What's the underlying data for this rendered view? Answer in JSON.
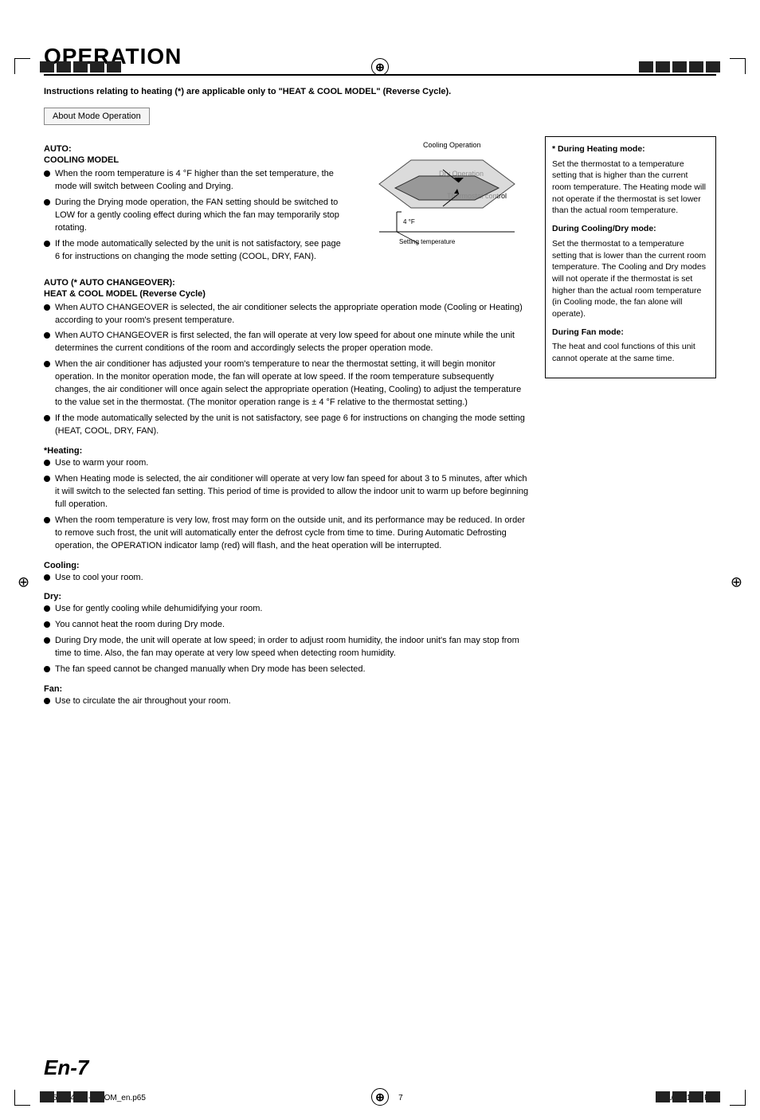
{
  "page": {
    "title": "OPERATION",
    "page_number": "En-7",
    "footer_left": "9359944072-01_OM_en.p65",
    "footer_center": "7",
    "footer_right": "1/21/10, 1:50 PM"
  },
  "instruction_note": "Instructions relating to heating (*) are applicable only to \"HEAT & COOL MODEL\" (Reverse Cycle).",
  "about_mode_label": "About Mode Operation",
  "auto_section": {
    "heading": "AUTO:",
    "subheading": "COOLING MODEL",
    "bullets": [
      "When the room temperature is 4 °F higher than the set temperature, the mode will switch between Cooling and Drying.",
      "During the Drying mode operation, the FAN setting should be switched to LOW for a gently cooling effect during which the fan may temporarily stop rotating.",
      "If the mode automatically selected by the unit is not satisfactory, see page 6 for instructions on changing the mode setting (COOL, DRY, FAN)."
    ]
  },
  "diagram": {
    "label_cooling": "Cooling Operation",
    "label_dry": "Dry Operation",
    "label_thermostat": "Thermostat control",
    "label_4f": "4 °F",
    "label_setting": "Setting temperature"
  },
  "auto_changeover_section": {
    "heading": "AUTO (* AUTO CHANGEOVER):",
    "subheading": "HEAT & COOL MODEL (Reverse Cycle)",
    "bullets": [
      "When AUTO CHANGEOVER is selected, the air conditioner selects the appropriate operation mode (Cooling or Heating) according to your room's present temperature.",
      "When AUTO CHANGEOVER is first selected, the fan will operate at very low speed for about one minute while the unit determines the current conditions of the room and accordingly selects the proper operation mode.",
      "When the air conditioner has adjusted your room's temperature to near the thermostat setting, it will begin monitor operation. In the monitor operation mode, the fan will operate at low speed. If the room temperature subsequently changes, the air conditioner will once again select the appropriate operation (Heating, Cooling) to adjust the temperature to the value set in the thermostat. (The monitor operation range is ± 4 °F relative to the thermostat setting.)",
      "If the mode automatically selected by the unit is not satisfactory, see page 6 for instructions on changing the mode setting (HEAT, COOL, DRY, FAN)."
    ]
  },
  "heating_section": {
    "heading": "*Heating:",
    "bullets": [
      "Use to warm your room.",
      "When Heating mode is selected, the air conditioner will operate at very low fan speed for about 3 to 5 minutes, after which it will switch to the selected fan setting. This period of time is provided to allow the indoor unit to warm up before beginning full operation.",
      "When the room temperature is very low, frost may form on the outside unit, and its performance may be reduced. In order to remove such frost, the unit will automatically enter the defrost cycle from time to time. During Automatic Defrosting operation, the OPERATION indicator lamp (red) will flash, and the heat operation will be interrupted."
    ]
  },
  "cooling_section": {
    "heading": "Cooling:",
    "bullets": [
      "Use to cool your room."
    ]
  },
  "dry_section": {
    "heading": "Dry:",
    "bullets": [
      "Use for gently cooling while dehumidifying your room.",
      "You cannot heat the room during Dry mode.",
      "During Dry mode, the unit will operate at low speed; in order to adjust room humidity, the indoor unit's fan may stop from time to time. Also, the fan may operate at very low speed when detecting room humidity.",
      "The fan speed cannot be changed manually when Dry mode has been selected."
    ]
  },
  "fan_section": {
    "heading": "Fan:",
    "bullets": [
      "Use to circulate the air throughout your room."
    ]
  },
  "sidebar": {
    "heating_mode_title": "* During Heating mode:",
    "heating_mode_text": "Set the thermostat to a temperature setting that is higher than the current room temperature. The Heating mode will not operate if the thermostat is set lower than the actual room temperature.",
    "cooling_dry_title": "During Cooling/Dry mode:",
    "cooling_dry_text": "Set the thermostat to a temperature setting that is lower than the current room temperature. The Cooling and Dry modes will not operate if the thermostat is set higher than the actual room temperature (in Cooling mode, the fan alone will operate).",
    "fan_mode_title": "During Fan mode:",
    "fan_mode_text": "The heat and cool functions of this unit cannot operate at the same time."
  }
}
